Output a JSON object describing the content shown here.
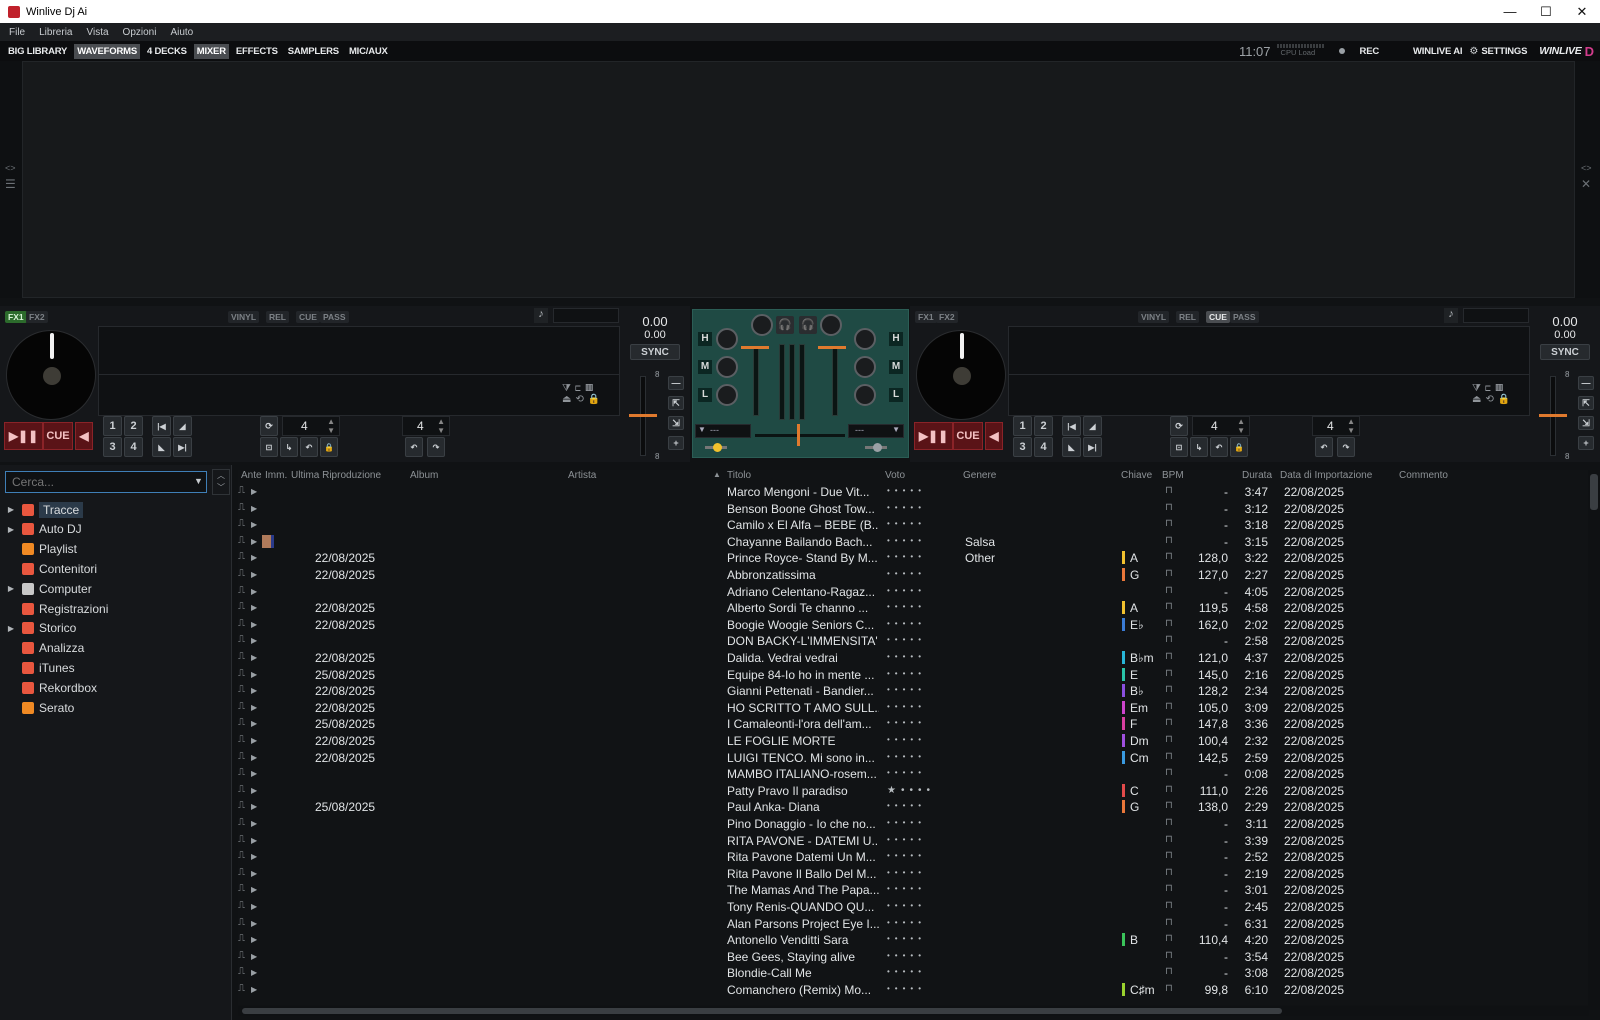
{
  "window": {
    "title": "Winlive Dj Ai",
    "minimize": "—",
    "maximize": "☐",
    "close": "✕"
  },
  "menu": [
    "File",
    "Libreria",
    "Vista",
    "Opzioni",
    "Aiuto"
  ],
  "toolbar": {
    "items": [
      {
        "label": "BIG LIBRARY",
        "active": false
      },
      {
        "label": "WAVEFORMS",
        "active": true
      },
      {
        "label": "4 DECKS",
        "active": false
      },
      {
        "label": "MIXER",
        "active": true
      },
      {
        "label": "EFFECTS",
        "active": false
      },
      {
        "label": "SAMPLERS",
        "active": false
      },
      {
        "label": "MIC/AUX",
        "active": false
      }
    ],
    "clock": "11:07",
    "cpu_label": "CPU Load",
    "rec": "REC",
    "winlive_ai": "WINLIVE AI",
    "settings": "SETTINGS",
    "brand": "WINLIVE"
  },
  "deck_left": {
    "fx1": "FX1",
    "fx2": "FX2",
    "vinyl": "VINYL",
    "rel": "REL",
    "cue_mode": "CUE",
    "pass": "PASS",
    "bpm": "0.00",
    "pitch": "0.00",
    "sync": "SYNC",
    "play": "▶❚❚",
    "cue": "CUE",
    "hotcues": [
      "1",
      "2",
      "3",
      "4"
    ],
    "loop": "4",
    "beatjump": "4",
    "fader_top": "8",
    "fader_bottom": "8"
  },
  "deck_right": {
    "fx1": "FX1",
    "fx2": "FX2",
    "vinyl": "VINYL",
    "rel": "REL",
    "cue_mode": "CUE",
    "pass": "PASS",
    "bpm": "0.00",
    "pitch": "0.00",
    "sync": "SYNC",
    "play": "▶❚❚",
    "cue": "CUE",
    "hotcues": [
      "1",
      "2",
      "3",
      "4"
    ],
    "loop": "4",
    "beatjump": "4",
    "fader_top": "8",
    "fader_bottom": "8"
  },
  "mixer": {
    "eq_labels": [
      "H",
      "M",
      "L"
    ],
    "fx_left": "---",
    "fx_right": "---"
  },
  "sidebar": {
    "search_placeholder": "Cerca...",
    "items": [
      {
        "label": "Tracce",
        "color": "#e9573f",
        "arrow": "▶",
        "selected": true
      },
      {
        "label": "Auto DJ",
        "color": "#e9573f",
        "arrow": "▶"
      },
      {
        "label": "Playlist",
        "color": "#f08a24",
        "arrow": ""
      },
      {
        "label": "Contenitori",
        "color": "#e9573f",
        "arrow": ""
      },
      {
        "label": "Computer",
        "color": "#c8c8c8",
        "arrow": "▶"
      },
      {
        "label": "Registrazioni",
        "color": "#e9573f",
        "arrow": ""
      },
      {
        "label": "Storico",
        "color": "#e9573f",
        "arrow": "▶"
      },
      {
        "label": "Analizza",
        "color": "#e9573f",
        "arrow": ""
      },
      {
        "label": "iTunes",
        "color": "#e9573f",
        "arrow": ""
      },
      {
        "label": "Rekordbox",
        "color": "#e9573f",
        "arrow": ""
      },
      {
        "label": "Serato",
        "color": "#f08a24",
        "arrow": ""
      }
    ]
  },
  "table": {
    "columns": [
      "Ante",
      "Imm.",
      "Ultima Riproduzione",
      "Album",
      "Artista",
      "Titolo",
      "Voto",
      "Genere",
      "Chiave",
      "BPM",
      "Durata",
      "Data di Importazione",
      "Commento"
    ],
    "sort_indicator": "▲",
    "rows": [
      {
        "last": "",
        "title": "Marco Mengoni - Due Vit...",
        "genre": "",
        "key": "",
        "keycolor": "",
        "bpm": "-",
        "dur": "3:47",
        "date": "22/08/2025"
      },
      {
        "last": "",
        "title": "Benson Boone Ghost Tow...",
        "genre": "",
        "key": "",
        "keycolor": "",
        "bpm": "-",
        "dur": "3:12",
        "date": "22/08/2025"
      },
      {
        "last": "",
        "title": "Camilo x El Alfa – BEBE (B...",
        "genre": "",
        "key": "",
        "keycolor": "",
        "bpm": "-",
        "dur": "3:18",
        "date": "22/08/2025"
      },
      {
        "last": "",
        "title": "Chayanne  Bailando Bach...",
        "genre": "Salsa",
        "key": "",
        "keycolor": "",
        "bpm": "-",
        "dur": "3:15",
        "date": "22/08/2025",
        "thumb": true
      },
      {
        "last": "22/08/2025",
        "title": "Prince Royce- Stand By M...",
        "genre": "Other",
        "key": "A",
        "keycolor": "#f2c12e",
        "bpm": "128,0",
        "dur": "3:22",
        "date": "22/08/2025"
      },
      {
        "last": "22/08/2025",
        "title": "Abbronzatissima",
        "genre": "",
        "key": "G",
        "keycolor": "#e9773a",
        "bpm": "127,0",
        "dur": "2:27",
        "date": "22/08/2025"
      },
      {
        "last": "",
        "title": "Adriano Celentano-Ragaz...",
        "genre": "",
        "key": "",
        "keycolor": "",
        "bpm": "-",
        "dur": "4:05",
        "date": "22/08/2025"
      },
      {
        "last": "22/08/2025",
        "title": "Alberto Sordi   Te channo ...",
        "genre": "",
        "key": "A",
        "keycolor": "#f2c12e",
        "bpm": "119,5",
        "dur": "4:58",
        "date": "22/08/2025"
      },
      {
        "last": "22/08/2025",
        "title": "Boogie Woogie Seniors C...",
        "genre": "",
        "key": "E♭",
        "keycolor": "#3a7bd5",
        "bpm": "162,0",
        "dur": "2:02",
        "date": "22/08/2025"
      },
      {
        "last": "",
        "title": "DON BACKY-L'IMMENSITA'",
        "genre": "",
        "key": "",
        "keycolor": "",
        "bpm": "-",
        "dur": "2:58",
        "date": "22/08/2025"
      },
      {
        "last": "22/08/2025",
        "title": "Dalida.   Vedrai  vedrai",
        "genre": "",
        "key": "B♭m",
        "keycolor": "#28b6d8",
        "bpm": "121,0",
        "dur": "4:37",
        "date": "22/08/2025"
      },
      {
        "last": "25/08/2025",
        "title": "Equipe 84-Io ho in mente ...",
        "genre": "",
        "key": "E",
        "keycolor": "#29c4a8",
        "bpm": "145,0",
        "dur": "2:16",
        "date": "22/08/2025"
      },
      {
        "last": "22/08/2025",
        "title": "Gianni Pettenati - Bandier...",
        "genre": "",
        "key": "B♭",
        "keycolor": "#8a4fe0",
        "bpm": "128,2",
        "dur": "2:34",
        "date": "22/08/2025"
      },
      {
        "last": "22/08/2025",
        "title": "HO SCRITTO T AMO SULL...",
        "genre": "",
        "key": "Em",
        "keycolor": "#cc44cc",
        "bpm": "105,0",
        "dur": "3:09",
        "date": "22/08/2025"
      },
      {
        "last": "25/08/2025",
        "title": "I Camaleonti-l'ora dell'am...",
        "genre": "",
        "key": "F",
        "keycolor": "#d93fa0",
        "bpm": "147,8",
        "dur": "3:36",
        "date": "22/08/2025"
      },
      {
        "last": "22/08/2025",
        "title": "LE FOGLIE  MORTE",
        "genre": "",
        "key": "Dm",
        "keycolor": "#a050e0",
        "bpm": "100,4",
        "dur": "2:32",
        "date": "22/08/2025"
      },
      {
        "last": "22/08/2025",
        "title": "LUIGI TENCO.  Mi sono in...",
        "genre": "",
        "key": "Cm",
        "keycolor": "#3a9ae0",
        "bpm": "142,5",
        "dur": "2:59",
        "date": "22/08/2025"
      },
      {
        "last": "",
        "title": "MAMBO ITALIANO-rosem...",
        "genre": "",
        "key": "",
        "keycolor": "",
        "bpm": "-",
        "dur": "0:08",
        "date": "22/08/2025"
      },
      {
        "last": "",
        "title": "Patty Pravo Il paradiso",
        "genre": "",
        "key": "C",
        "keycolor": "#e24a4a",
        "bpm": "111,0",
        "dur": "2:26",
        "date": "22/08/2025",
        "star": true
      },
      {
        "last": "25/08/2025",
        "title": "Paul Anka- Diana",
        "genre": "",
        "key": "G",
        "keycolor": "#e9773a",
        "bpm": "138,0",
        "dur": "2:29",
        "date": "22/08/2025"
      },
      {
        "last": "",
        "title": "Pino Donaggio - Io che no...",
        "genre": "",
        "key": "",
        "keycolor": "",
        "bpm": "-",
        "dur": "3:11",
        "date": "22/08/2025"
      },
      {
        "last": "",
        "title": "RITA PAVONE - DATEMI U...",
        "genre": "",
        "key": "",
        "keycolor": "",
        "bpm": "-",
        "dur": "3:39",
        "date": "22/08/2025"
      },
      {
        "last": "",
        "title": "Rita Pavone  Datemi Un M...",
        "genre": "",
        "key": "",
        "keycolor": "",
        "bpm": "-",
        "dur": "2:52",
        "date": "22/08/2025"
      },
      {
        "last": "",
        "title": "Rita Pavone  Il Ballo Del M...",
        "genre": "",
        "key": "",
        "keycolor": "",
        "bpm": "-",
        "dur": "2:19",
        "date": "22/08/2025"
      },
      {
        "last": "",
        "title": "The Mamas And The Papa...",
        "genre": "",
        "key": "",
        "keycolor": "",
        "bpm": "-",
        "dur": "3:01",
        "date": "22/08/2025"
      },
      {
        "last": "",
        "title": "Tony Renis-QUANDO QU...",
        "genre": "",
        "key": "",
        "keycolor": "",
        "bpm": "-",
        "dur": "2:45",
        "date": "22/08/2025"
      },
      {
        "last": "",
        "title": "Alan Parsons Project Eye I...",
        "genre": "",
        "key": "",
        "keycolor": "",
        "bpm": "-",
        "dur": "6:31",
        "date": "22/08/2025"
      },
      {
        "last": "",
        "title": "Antonello Venditti  Sara",
        "genre": "",
        "key": "B",
        "keycolor": "#3ac45a",
        "bpm": "110,4",
        "dur": "4:20",
        "date": "22/08/2025"
      },
      {
        "last": "",
        "title": "Bee Gees, Staying alive",
        "genre": "",
        "key": "",
        "keycolor": "",
        "bpm": "-",
        "dur": "3:54",
        "date": "22/08/2025"
      },
      {
        "last": "",
        "title": "Blondie-Call Me",
        "genre": "",
        "key": "",
        "keycolor": "",
        "bpm": "-",
        "dur": "3:08",
        "date": "22/08/2025"
      },
      {
        "last": "",
        "title": "Comanchero (Remix) Mo...",
        "genre": "",
        "key": "C♯m",
        "keycolor": "#9ad22e",
        "bpm": "99,8",
        "dur": "6:10",
        "date": "22/08/2025"
      }
    ]
  }
}
